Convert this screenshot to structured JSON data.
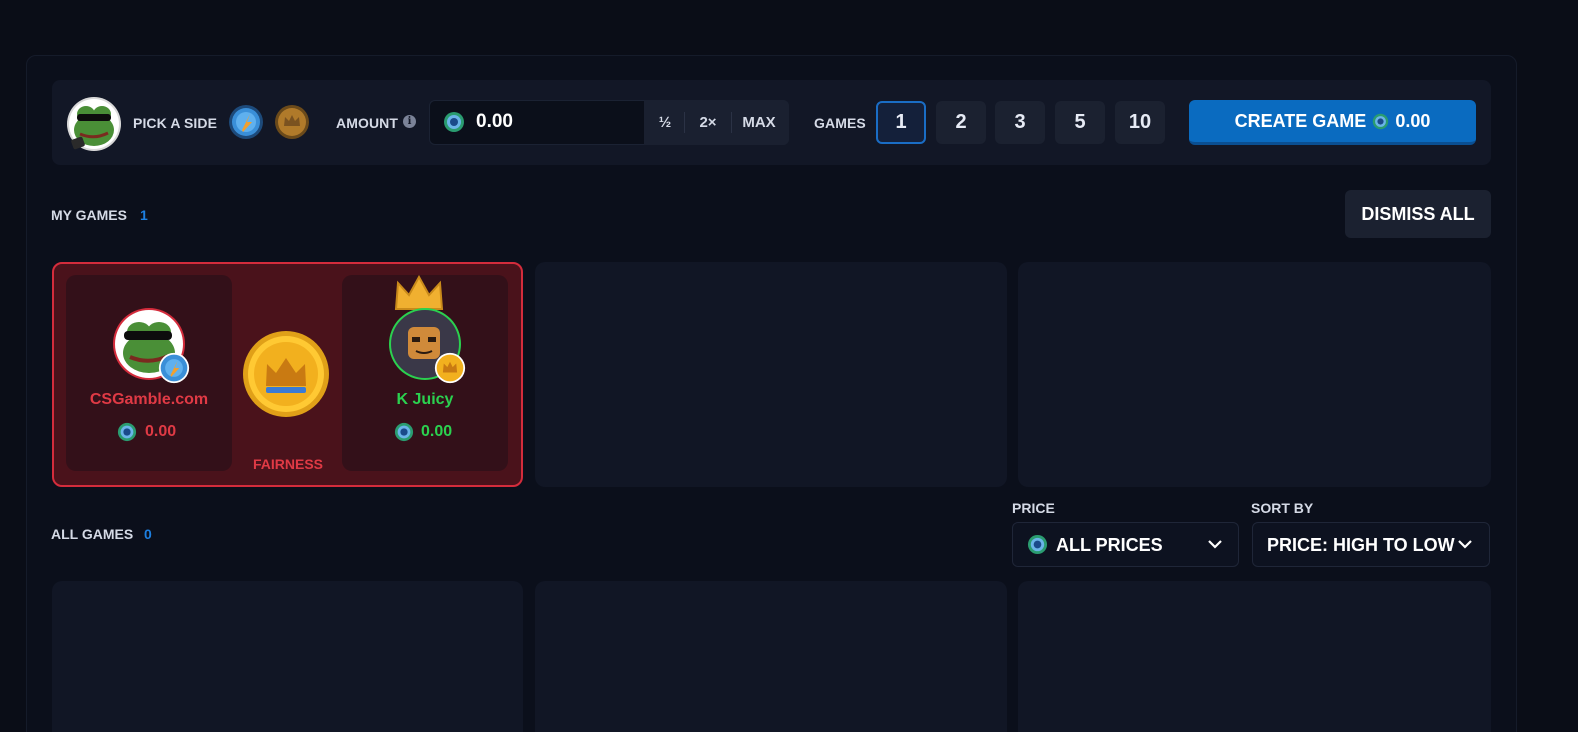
{
  "top_bar": {
    "pick_side_label": "PICK A SIDE",
    "amount_label": "AMOUNT",
    "amount_info": "i",
    "amount_value": "0.00",
    "half_label": "½",
    "double_label": "2×",
    "max_label": "MAX",
    "games_label": "GAMES",
    "games_options": [
      "1",
      "2",
      "3",
      "5",
      "10"
    ],
    "selected_games": "1",
    "create_label": "CREATE GAME",
    "create_amount": "0.00"
  },
  "my_games": {
    "title": "MY GAMES",
    "count": "1",
    "dismiss_label": "DISMISS ALL",
    "game": {
      "player1_name": "CSGamble.com",
      "player1_amount": "0.00",
      "player2_name": "K Juicy",
      "player2_amount": "0.00",
      "fairness_label": "FAIRNESS"
    }
  },
  "all_games": {
    "title": "ALL GAMES",
    "count": "0",
    "price_label": "PRICE",
    "price_value": "ALL PRICES",
    "sort_label": "SORT BY",
    "sort_value": "PRICE: HIGH TO LOW"
  },
  "colors": {
    "accent_blue": "#0a6bc0",
    "loss_red": "#e03a45",
    "win_green": "#2bd14f",
    "card_bg": "#111625"
  },
  "icons": [
    "frog-avatar-icon",
    "blue-coin-icon",
    "gold-crown-coin-icon",
    "currency-gem-icon",
    "crown-icon",
    "chevron-down-icon"
  ]
}
